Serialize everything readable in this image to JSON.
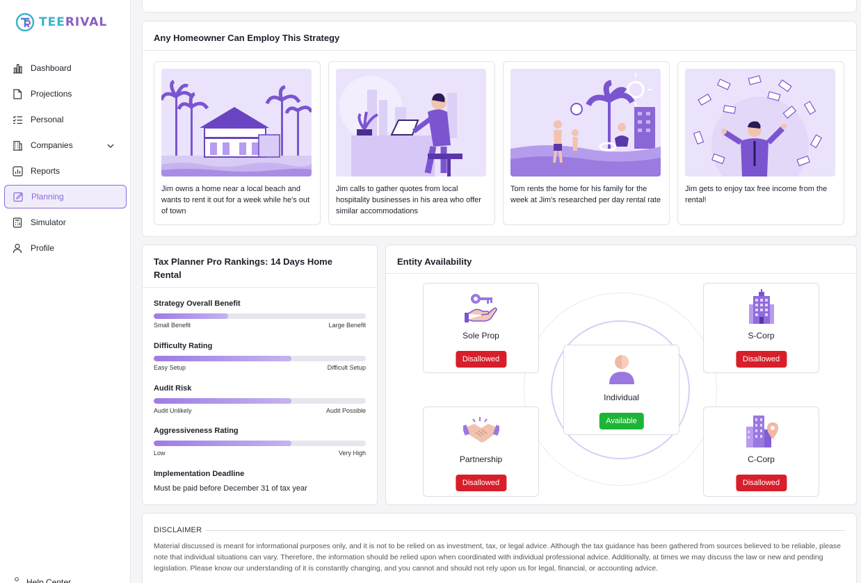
{
  "app": {
    "logo_text_1": "TEE",
    "logo_text_2": "RIVAL",
    "accent_color": "#8d6ad8"
  },
  "sidebar": {
    "items": [
      {
        "label": "Dashboard",
        "icon": "bar-chart-icon"
      },
      {
        "label": "Projections",
        "icon": "document-icon"
      },
      {
        "label": "Personal",
        "icon": "checklist-icon"
      },
      {
        "label": "Companies",
        "icon": "building-icon"
      },
      {
        "label": "Reports",
        "icon": "chart-box-icon"
      },
      {
        "label": "Planning",
        "icon": "edit-icon",
        "active": true
      },
      {
        "label": "Simulator",
        "icon": "calculator-icon"
      },
      {
        "label": "Profile",
        "icon": "user-icon"
      }
    ],
    "help_label": "Help Center"
  },
  "strategy": {
    "title": "Any Homeowner Can Employ This Strategy",
    "cards": [
      {
        "text": "Jim owns a home near a local beach and wants to rent it out for a week while he's out of town",
        "illustration": "beach-house-illustration"
      },
      {
        "text": "Jim calls to gather quotes from local hospitality businesses in his area who offer similar accommodations",
        "illustration": "laptop-worker-illustration"
      },
      {
        "text": "Tom rents the home for his family for the week at Jim's researched per day rental rate",
        "illustration": "family-beach-illustration"
      },
      {
        "text": "Jim gets to enjoy tax free income from the rental!",
        "illustration": "money-rain-illustration"
      }
    ]
  },
  "rankings": {
    "title": "Tax Planner Pro Rankings: 14 Days Home Rental",
    "items": [
      {
        "label": "Strategy Overall Benefit",
        "value": 0.35,
        "min_label": "Small Benefit",
        "max_label": "Large Benefit"
      },
      {
        "label": "Difficulty Rating",
        "value": 0.65,
        "min_label": "Easy Setup",
        "max_label": "Difficult Setup"
      },
      {
        "label": "Audit Risk",
        "value": 0.65,
        "min_label": "Audit Unlikely",
        "max_label": "Audit Possible"
      },
      {
        "label": "Aggressiveness Rating",
        "value": 0.65,
        "min_label": "Low",
        "max_label": "Very High"
      }
    ],
    "deadline_label": "Implementation Deadline",
    "deadline_value": "Must be paid before December 31 of tax year"
  },
  "entities": {
    "title": "Entity Availability",
    "sole_prop": {
      "name": "Sole Prop",
      "status": "Disallowed",
      "icon": "key-hand-icon"
    },
    "s_corp": {
      "name": "S-Corp",
      "status": "Disallowed",
      "icon": "office-building-icon"
    },
    "individual": {
      "name": "Individual",
      "status": "Available",
      "icon": "person-icon"
    },
    "partnership": {
      "name": "Partnership",
      "status": "Disallowed",
      "icon": "handshake-icon"
    },
    "c_corp": {
      "name": "C-Corp",
      "status": "Disallowed",
      "icon": "city-building-icon"
    },
    "colors": {
      "disallowed": "#d81e2a",
      "available": "#1db536"
    }
  },
  "disclaimer": {
    "heading": "DISCLAIMER",
    "text": "Material discussed is meant for informational purposes only, and it is not to be relied on as investment, tax, or legal advice. Although the tax guidance has been gathered from sources believed to be reliable, please note that individual situations can vary. Therefore, the information should be relied upon when coordinated with individual professional advice. Additionally, at times we may discuss the law or new and pending legislation. Please know our understanding of it is constantly changing, and you cannot and should not rely upon us for legal, financial, or accounting advice."
  }
}
